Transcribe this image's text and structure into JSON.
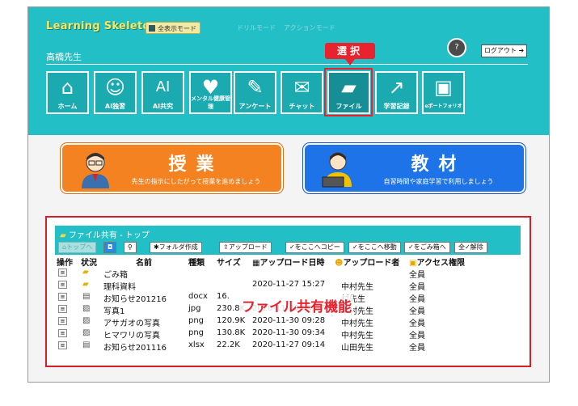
{
  "app": {
    "logo": "Learning Skeleton",
    "modes": [
      "全表示モード",
      "ドリルモード",
      "アクションモード"
    ],
    "teacher": "高橋先生",
    "help_icon": "question-icon",
    "logout_label": "ログアウト",
    "select_badge": "選択"
  },
  "nav": [
    {
      "label": "ホーム",
      "icon": "home-icon"
    },
    {
      "label": "AI独習",
      "icon": "ai-head-icon"
    },
    {
      "label": "AI共究",
      "icon": "ai-search-icon"
    },
    {
      "label": "メンタル健康管理",
      "icon": "heart-icon"
    },
    {
      "label": "アンケート",
      "icon": "clipboard-icon"
    },
    {
      "label": "チャット",
      "icon": "chat-icon"
    },
    {
      "label": "ファイル",
      "icon": "folder-icon"
    },
    {
      "label": "学習記録",
      "icon": "chart-icon"
    },
    {
      "label": "eポートフォリオ",
      "icon": "portfolio-icon"
    }
  ],
  "big": {
    "lesson_title": "授業",
    "lesson_sub": "先生の指示にしたがって授業を進めましょう",
    "material_title": "教材",
    "material_sub": "自習時間や家庭学習で利用しましょう"
  },
  "files": {
    "title": "ファイル共有 - トップ",
    "toolbar": {
      "top": "トップへ",
      "new_folder": "フォルダ作成",
      "upload": "アップロード",
      "copy_here": "✓をここへコピー",
      "move_here": "✓をここへ移動",
      "to_trash": "✓をごみ箱へ",
      "toggle_all": "全✓解除"
    },
    "headers": {
      "op": "操作",
      "status": "状況",
      "name": "名前",
      "type": "種類",
      "size": "サイズ",
      "date": "アップロード日時",
      "uploader": "アップロード者",
      "access": "アクセス権限"
    },
    "rows": [
      {
        "name": "ごみ箱",
        "type": "",
        "size": "",
        "date": "",
        "uploader": "",
        "access": "全員",
        "kind": "folder"
      },
      {
        "name": "理科資料",
        "type": "",
        "size": "",
        "date": "2020-11-27 15:27",
        "uploader": "中村先生",
        "access": "全員",
        "kind": "folder"
      },
      {
        "name": "お知らせ201216",
        "type": "docx",
        "size": "16.",
        "date": "",
        "uploader": "村先生",
        "access": "全員",
        "kind": "doc"
      },
      {
        "name": "写真1",
        "type": "jpg",
        "size": "230.8K",
        "date": "2020-11-30 09:37",
        "uploader": "中村先生",
        "access": "全員",
        "kind": "image"
      },
      {
        "name": "アサガオの写真",
        "type": "png",
        "size": "120.9K",
        "date": "2020-11-30 09:28",
        "uploader": "中村先生",
        "access": "全員",
        "kind": "image"
      },
      {
        "name": "ヒマワリの写真",
        "type": "png",
        "size": "130.8K",
        "date": "2020-11-30 09:34",
        "uploader": "中村先生",
        "access": "全員",
        "kind": "image"
      },
      {
        "name": "お知らせ201116",
        "type": "xlsx",
        "size": "22.2K",
        "date": "2020-11-27 09:14",
        "uploader": "山田先生",
        "access": "全員",
        "kind": "doc"
      }
    ],
    "overlay_label": "ファイル共有機能"
  },
  "colors": {
    "teal": "#22c0c6",
    "red": "#e8232e",
    "orange": "#f58220",
    "blue": "#1e73e8"
  }
}
